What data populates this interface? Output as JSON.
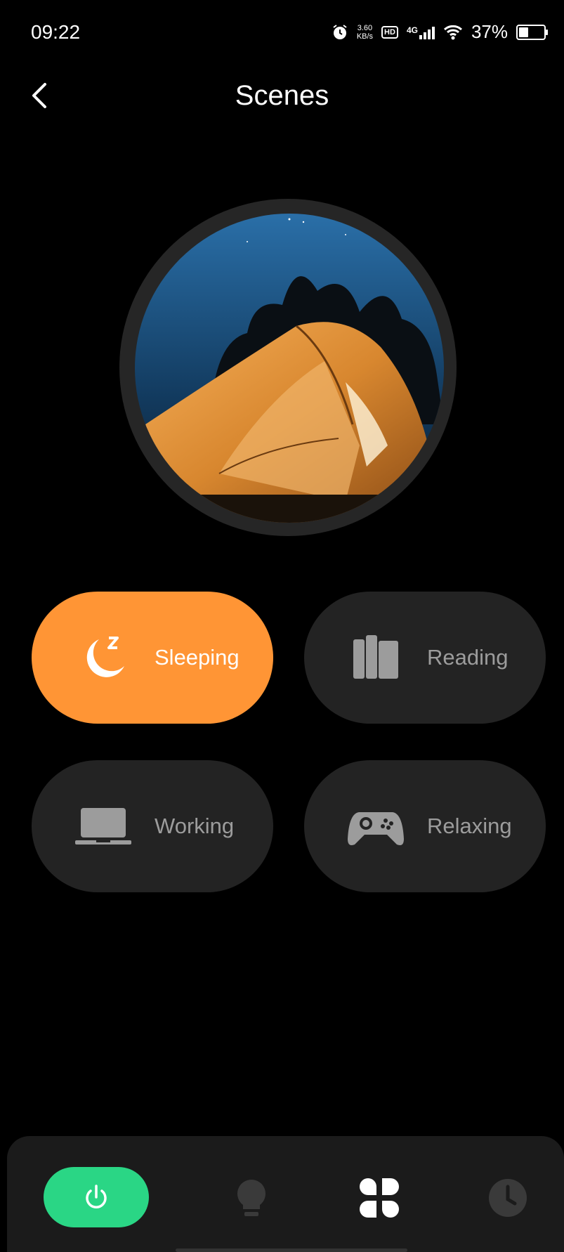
{
  "status_bar": {
    "time": "09:22",
    "net_speed_value": "3.60",
    "net_speed_unit": "KB/s",
    "hd_label": "HD",
    "network": "4G",
    "battery": "37%",
    "battery_level": 0.37
  },
  "header": {
    "title": "Scenes",
    "back_icon": "chevron-left-icon"
  },
  "hero": {
    "image": "tent-at-night-photo"
  },
  "scenes": [
    {
      "label": "Sleeping",
      "icon": "moon-sleep-icon",
      "active": true
    },
    {
      "label": "Reading",
      "icon": "book-icon",
      "active": false
    },
    {
      "label": "Working",
      "icon": "laptop-icon",
      "active": false
    },
    {
      "label": "Relaxing",
      "icon": "gamepad-icon",
      "active": false
    }
  ],
  "bottom_nav": [
    {
      "icon": "power-icon",
      "active": true
    },
    {
      "icon": "lightbulb-icon",
      "active": false
    },
    {
      "icon": "scenes-grid-icon",
      "active": false
    },
    {
      "icon": "clock-icon",
      "active": false
    }
  ],
  "colors": {
    "background": "#000000",
    "accent_orange": "#ff9535",
    "power_green": "#2ad685",
    "card": "#232323",
    "inactive_text": "#9c9c9c"
  }
}
